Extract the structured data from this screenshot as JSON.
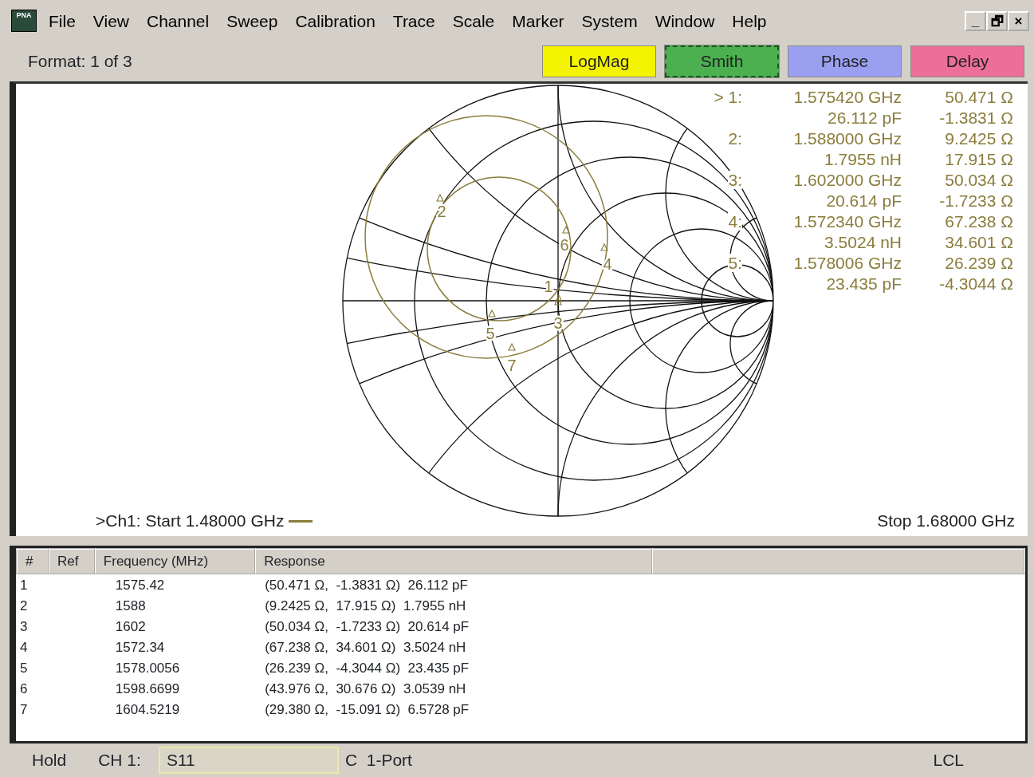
{
  "menu": [
    "File",
    "View",
    "Channel",
    "Sweep",
    "Calibration",
    "Trace",
    "Scale",
    "Marker",
    "System",
    "Window",
    "Help"
  ],
  "app_icon_text": "PNA",
  "window_controls": [
    "_",
    "🗗",
    "×"
  ],
  "toolbar": {
    "format": "Format: 1 of 3",
    "buttons": [
      {
        "label": "LogMag",
        "color": "#f4f400",
        "selected": false
      },
      {
        "label": "Smith",
        "color": "#4caf50",
        "selected": true
      },
      {
        "label": "Phase",
        "color": "#9a9ff0",
        "selected": false
      },
      {
        "label": "Delay",
        "color": "#ec6f9a",
        "selected": false
      }
    ]
  },
  "chart": {
    "marker_labels": [
      "1",
      "2",
      "3",
      "4",
      "5",
      "6",
      "7"
    ],
    "start": ">Ch1: Start  1.48000 GHz",
    "stop": "Stop  1.68000 GHz",
    "marker_readouts": [
      {
        "label": "> 1:",
        "frequency": "1.575420 GHz",
        "value": "26.112 pF",
        "resistance": "50.471 Ω",
        "reactance": "-1.3831 Ω"
      },
      {
        "label": "2:",
        "frequency": "1.588000 GHz",
        "value": "1.7955 nH",
        "resistance": "9.2425 Ω",
        "reactance": "17.915 Ω"
      },
      {
        "label": "3:",
        "frequency": "1.602000 GHz",
        "value": "20.614 pF",
        "resistance": "50.034 Ω",
        "reactance": "-1.7233 Ω"
      },
      {
        "label": "4:",
        "frequency": "1.572340 GHz",
        "value": "3.5024 nH",
        "resistance": "67.238 Ω",
        "reactance": "34.601 Ω"
      },
      {
        "label": "5:",
        "frequency": "1.578006 GHz",
        "value": "23.435 pF",
        "resistance": "26.239 Ω",
        "reactance": "-4.3044 Ω"
      }
    ]
  },
  "marker_table": {
    "columns": [
      "#",
      "Ref",
      "Frequency (MHz)",
      "Response"
    ],
    "rows": [
      {
        "number": "1",
        "frequency": "1575.42",
        "response": "(50.471 Ω,  -1.3831 Ω)  26.112 pF"
      },
      {
        "number": "2",
        "frequency": "1588",
        "response": "(9.2425 Ω,  17.915 Ω)  1.7955 nH"
      },
      {
        "number": "3",
        "frequency": "1602",
        "response": "(50.034 Ω,  -1.7233 Ω)  20.614 pF"
      },
      {
        "number": "4",
        "frequency": "1572.34",
        "response": "(67.238 Ω,  34.601 Ω)  3.5024 nH"
      },
      {
        "number": "5",
        "frequency": "1578.0056",
        "response": "(26.239 Ω,  -4.3044 Ω)  23.435 pF"
      },
      {
        "number": "6",
        "frequency": "1598.6699",
        "response": "(43.976 Ω,  30.676 Ω)  3.0539 nH"
      },
      {
        "number": "7",
        "frequency": "1604.5219",
        "response": "(29.380 Ω,  -15.091 Ω)  6.5728 pF"
      }
    ]
  },
  "status_bar": {
    "mode": "Hold",
    "channel": "CH 1:",
    "measurement": "S11",
    "calibration": "C  1-Port",
    "control": "LCL"
  }
}
